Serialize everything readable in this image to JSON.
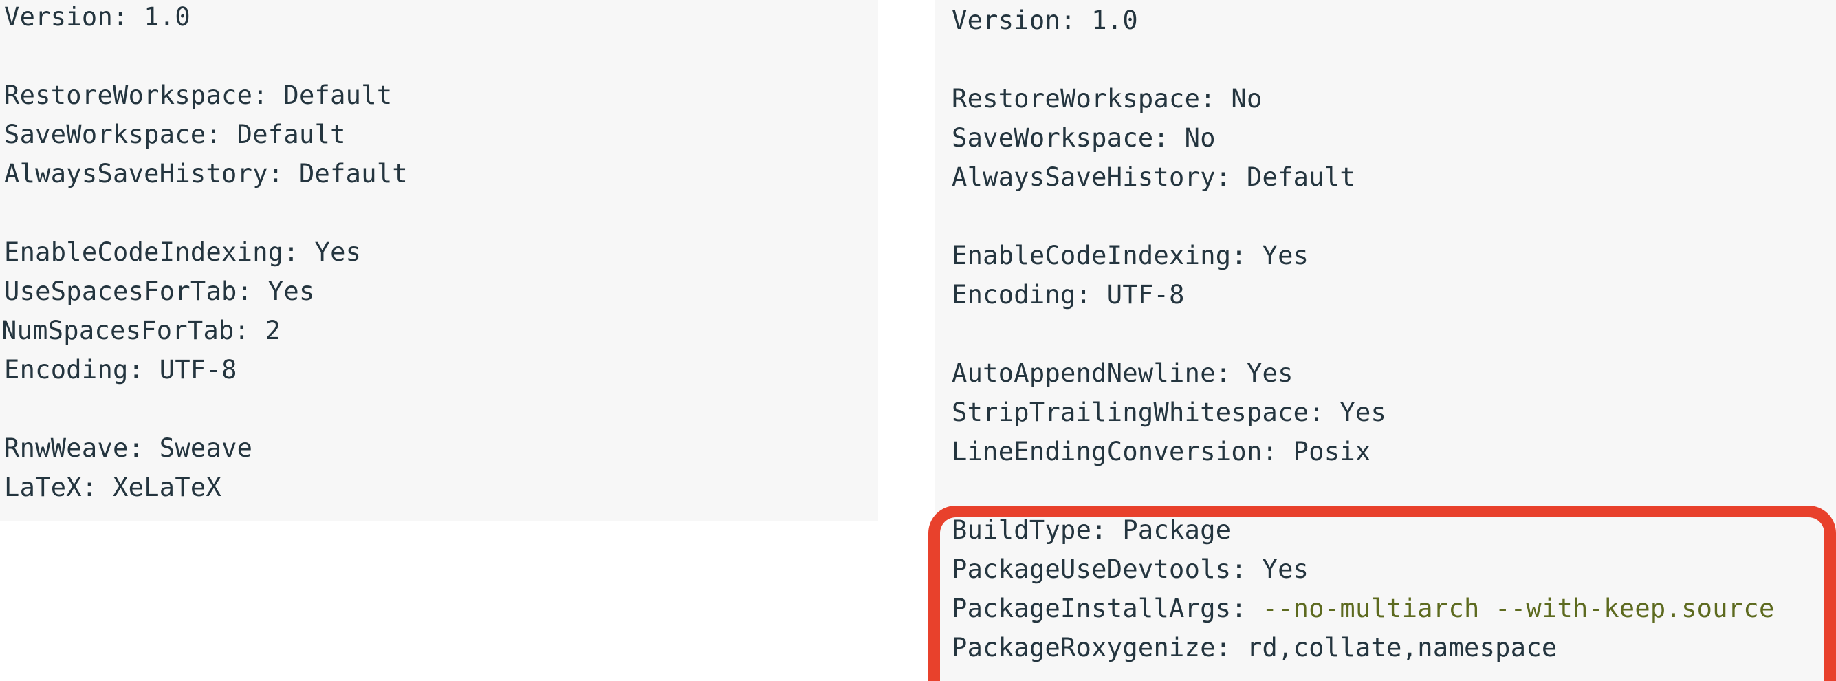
{
  "left_file": {
    "lines": [
      {
        "key": "Version:",
        "value": "1.0"
      },
      {
        "key": "",
        "value": ""
      },
      {
        "key": "RestoreWorkspace:",
        "value": "Default"
      },
      {
        "key": "SaveWorkspace:",
        "value": "Default"
      },
      {
        "key": "AlwaysSaveHistory:",
        "value": "Default"
      },
      {
        "key": "",
        "value": ""
      },
      {
        "key": "EnableCodeIndexing:",
        "value": "Yes"
      },
      {
        "key": "UseSpacesForTab:",
        "value": "Yes"
      },
      {
        "key": "NumSpacesForTab:",
        "value": "2"
      },
      {
        "key": "Encoding:",
        "value": "UTF-8"
      },
      {
        "key": "",
        "value": ""
      },
      {
        "key": "RnwWeave:",
        "value": "Sweave"
      },
      {
        "key": "LaTeX:",
        "value": "XeLaTeX"
      }
    ]
  },
  "right_file": {
    "lines": [
      {
        "key": "Version:",
        "value": "1.0"
      },
      {
        "key": "",
        "value": ""
      },
      {
        "key": "RestoreWorkspace:",
        "value": "No"
      },
      {
        "key": "SaveWorkspace:",
        "value": "No"
      },
      {
        "key": "AlwaysSaveHistory:",
        "value": "Default"
      },
      {
        "key": "",
        "value": ""
      },
      {
        "key": "EnableCodeIndexing:",
        "value": "Yes"
      },
      {
        "key": "Encoding:",
        "value": "UTF-8"
      },
      {
        "key": "",
        "value": ""
      },
      {
        "key": "AutoAppendNewline:",
        "value": "Yes"
      },
      {
        "key": "StripTrailingWhitespace:",
        "value": "Yes"
      },
      {
        "key": "LineEndingConversion:",
        "value": "Posix"
      },
      {
        "key": "",
        "value": ""
      },
      {
        "key": "BuildType:",
        "value": "Package"
      },
      {
        "key": "PackageUseDevtools:",
        "value": "Yes"
      },
      {
        "key": "PackageInstallArgs:",
        "value": "--no-multiarch --with-keep.source"
      },
      {
        "key": "PackageRoxygenize:",
        "value": "rd,collate,namespace"
      }
    ]
  },
  "colors": {
    "panel_background": "#f7f7f7",
    "text": "#24353f",
    "string_value": "#5d6a1f",
    "highlight_border": "#e8412c"
  }
}
